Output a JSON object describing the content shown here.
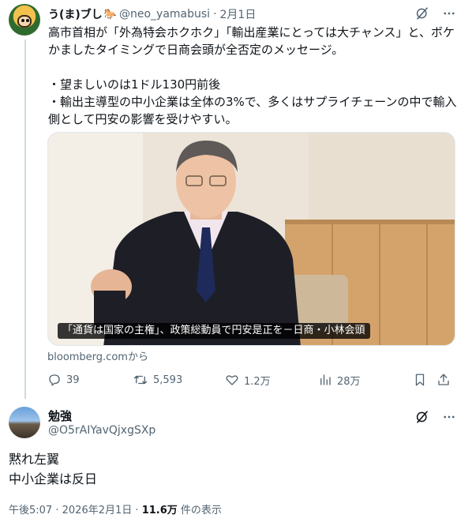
{
  "tweet": {
    "author_name": "う(ま)ブし",
    "author_emoji": "🐎",
    "handle": "@neo_yamabusi",
    "separator": "·",
    "date": "2月1日",
    "text": "高市首相が「外為特会ホクホク」「輸出産業にとっては大チャンス」と、ボケかましたタイミングで日商会頭が全否定のメッセージ。\n\n・望ましいのは1ドル130円前後\n・輸出主導型の中小企業は全体の3%で、多くはサプライチェーンの中で輸入側として円安の影響を受けやすい。",
    "card": {
      "caption": "「通貨は国家の主権」、政策総動員で円安是正を－日商・小林会頭",
      "source": "bloomberg.comから"
    },
    "actions": {
      "replies": "39",
      "retweets": "5,593",
      "likes": "1.2万",
      "views": "28万"
    }
  },
  "reply": {
    "author_name": "勉強",
    "handle": "@O5rAIYavQjxgSXp",
    "line1": "黙れ左翼",
    "line2": "中小企業は反日",
    "time": "午後5:07",
    "separator1": "·",
    "date": "2026年2月1日",
    "separator2": "·",
    "views_count": "11.6万",
    "views_label": "件の表示"
  },
  "icons": [
    "grok-icon",
    "more-icon",
    "reply-icon",
    "retweet-icon",
    "like-icon",
    "views-icon",
    "bookmark-icon",
    "share-icon"
  ],
  "colors": {
    "text": "#0f1419",
    "muted": "#536471",
    "border": "#cfd9de"
  }
}
